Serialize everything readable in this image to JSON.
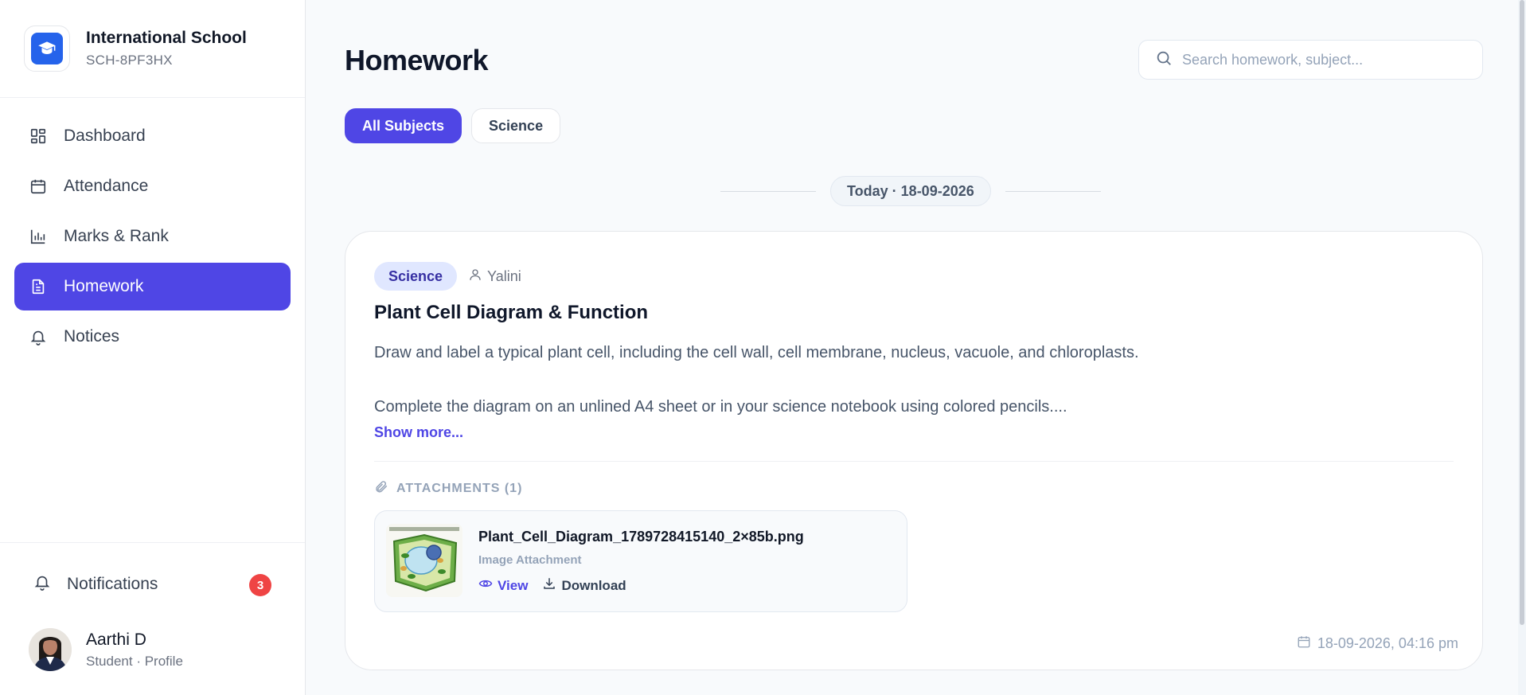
{
  "brand": {
    "name": "International School",
    "code": "SCH-8PF3HX"
  },
  "sidebar": {
    "items": [
      {
        "label": "Dashboard",
        "icon": "dashboard-icon",
        "active": false
      },
      {
        "label": "Attendance",
        "icon": "calendar-icon",
        "active": false
      },
      {
        "label": "Marks & Rank",
        "icon": "bar-chart-icon",
        "active": false
      },
      {
        "label": "Homework",
        "icon": "document-icon",
        "active": true
      },
      {
        "label": "Notices",
        "icon": "bell-icon",
        "active": false
      }
    ],
    "notifications": {
      "label": "Notifications",
      "count": "3"
    },
    "profile": {
      "name": "Aarthi D",
      "subtitle": "Student · Profile"
    }
  },
  "main": {
    "title": "Homework",
    "search": {
      "placeholder": "Search homework, subject...",
      "value": ""
    },
    "filters": [
      {
        "label": "All Subjects",
        "active": true
      },
      {
        "label": "Science",
        "active": false
      }
    ],
    "date_group": "Today · 18-09-2026",
    "homework": {
      "subject": "Science",
      "teacher": "Yalini",
      "title": "Plant Cell Diagram & Function",
      "description_line1": "Draw and label a typical plant cell, including the cell wall, cell membrane, nucleus, vacuole, and chloroplasts.",
      "description_line2": "Complete the diagram on an unlined A4 sheet or in your science notebook using colored pencils....",
      "show_more": "Show more...",
      "attachments_header": "ATTACHMENTS (1)",
      "attachment": {
        "file_name": "Plant_Cell_Diagram_1789728415140_2×85b.png",
        "type": "Image Attachment",
        "view_label": "View",
        "download_label": "Download"
      },
      "created_at": "18-09-2026, 04:16 pm"
    }
  },
  "colors": {
    "accent": "#4f46e5",
    "brand_logo": "#2563eb",
    "badge": "#ef4444",
    "subject_tag_bg": "#e0e7ff",
    "subject_tag_text": "#3730a3"
  }
}
